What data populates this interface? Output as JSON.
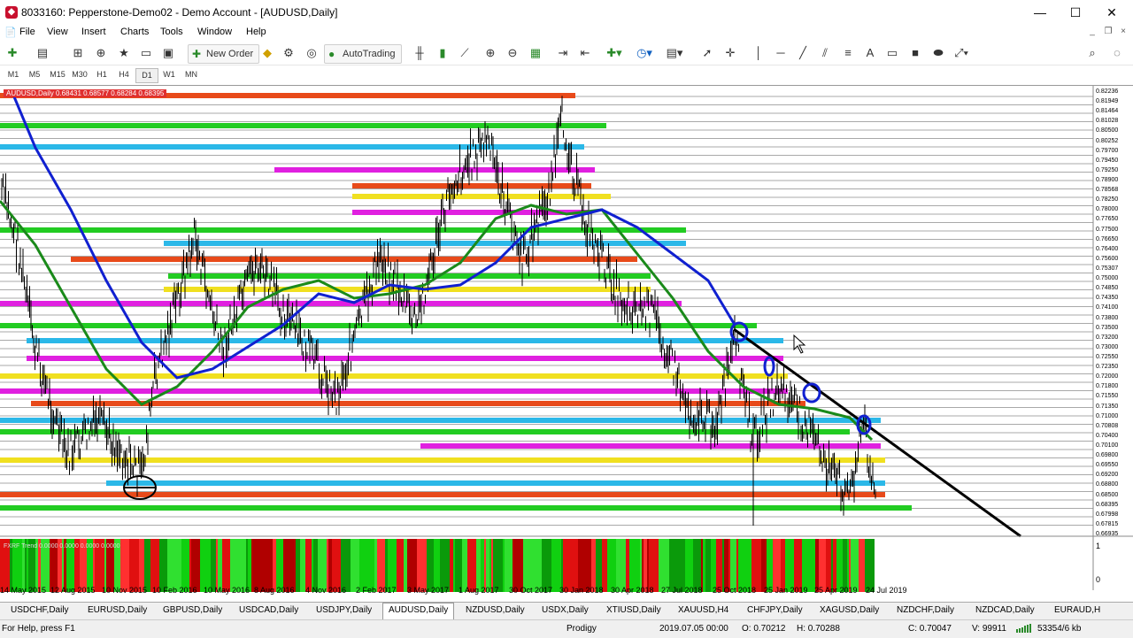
{
  "window": {
    "title": "8033160: Pepperstone-Demo02 - Demo Account - [AUDUSD,Daily]",
    "minimize": "—",
    "maximize": "☐",
    "close": "✕"
  },
  "menu": [
    "File",
    "View",
    "Insert",
    "Charts",
    "Tools",
    "Window",
    "Help"
  ],
  "toolbar": {
    "new_order": "New Order",
    "auto_trading": "AutoTrading"
  },
  "timeframes": [
    "M1",
    "M5",
    "M15",
    "M30",
    "H1",
    "H4",
    "D1",
    "W1",
    "MN"
  ],
  "active_timeframe": "D1",
  "chart": {
    "header": "AUDUSD,Daily 0.68431 0.68577 0.68284 0.68395",
    "indicator_label": "FXRF Trend 0.0000 0.0000 0.0000 0.0000",
    "price_labels": [
      "0.82236",
      "0.81949",
      "0.81464",
      "0.81028",
      "0.80500",
      "0.80252",
      "0.79700",
      "0.79450",
      "0.79250",
      "0.78900",
      "0.78568",
      "0.78250",
      "0.78000",
      "0.77650",
      "0.77500",
      "0.76650",
      "0.76400",
      "0.75600",
      "0.75307",
      "0.75000",
      "0.74850",
      "0.74350",
      "0.74100",
      "0.73800",
      "0.73500",
      "0.73200",
      "0.73000",
      "0.72550",
      "0.72350",
      "0.72000",
      "0.71800",
      "0.71550",
      "0.71350",
      "0.71000",
      "0.70808",
      "0.70400",
      "0.70100",
      "0.69800",
      "0.69550",
      "0.69200",
      "0.68800",
      "0.68500",
      "0.68395",
      "0.67998",
      "0.67815",
      "0.66935"
    ],
    "indicator_scale_top": "1",
    "indicator_scale_bottom": "0",
    "dates": [
      "14 May 2015",
      "12 Aug 2015",
      "10 Nov 2015",
      "10 Feb 2016",
      "10 May 2016",
      "8 Aug 2016",
      "4 Nov 2016",
      "2 Feb 2017",
      "3 May 2017",
      "1 Aug 2017",
      "30 Oct 2017",
      "30 Jan 2018",
      "30 Apr 2018",
      "27 Jul 2018",
      "25 Oct 2018",
      "25 Jan 2019",
      "25 Apr 2019",
      "24 Jul 2019"
    ]
  },
  "tabs": [
    "USDCHF,Daily",
    "EURUSD,Daily",
    "GBPUSD,Daily",
    "USDCAD,Daily",
    "USDJPY,Daily",
    "AUDUSD,Daily",
    "NZDUSD,Daily",
    "USDX,Daily",
    "XTIUSD,Daily",
    "XAUUSD,H4",
    "CHFJPY,Daily",
    "XAGUSD,Daily",
    "NZDCHF,Daily",
    "NZDCAD,Daily",
    "EURAUD,H"
  ],
  "active_tab": "AUDUSD,Daily",
  "status": {
    "help": "For Help, press F1",
    "profile": "Prodigy",
    "datetime": "2019.07.05 00:00",
    "open": "O: 0.70212",
    "high": "H: 0.70288",
    "close": "C: 0.70047",
    "volume": "V: 99911",
    "traffic": "53354/6 kb"
  }
}
